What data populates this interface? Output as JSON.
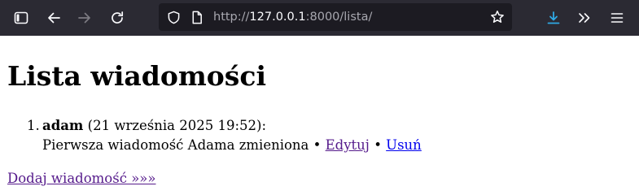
{
  "browser": {
    "url_scheme": "http://",
    "url_host": "127.0.0.1",
    "url_rest": ":8000/lista/",
    "accent_color": "#2fa9e5"
  },
  "page": {
    "title": "Lista wiadomości",
    "messages": [
      {
        "number": "1.",
        "author": "adam",
        "date": "(21 września 2025 19:52):",
        "text": "Pierwsza wiadomość Adama zmieniona",
        "separator": "•",
        "edit_label": "Edytuj",
        "delete_label": "Usuń"
      }
    ],
    "add_link": "Dodaj wiadomość »»»"
  },
  "colors": {
    "link_visited": "#551a8b",
    "link_unvisited": "#0000ee",
    "toolbar_bg": "#2b2a33",
    "urlbar_bg": "#1c1b22"
  },
  "icons": [
    "sidebar-icon",
    "back-icon",
    "forward-icon",
    "reload-icon",
    "shield-icon",
    "page-icon",
    "bookmark-star-icon",
    "download-icon",
    "overflow-chevrons-icon",
    "menu-icon"
  ]
}
